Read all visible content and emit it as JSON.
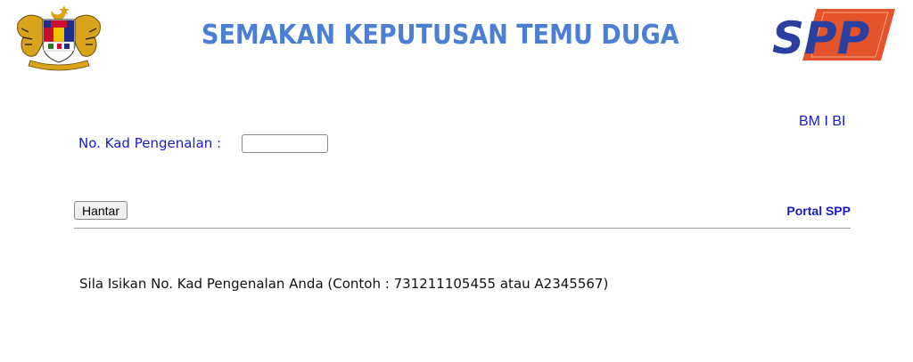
{
  "header": {
    "title": "SEMAKAN KEPUTUSAN TEMU DUGA",
    "crest_icon": "malaysia-coat-of-arms",
    "logo_text": "SPP",
    "logo_colors": {
      "text": "#2a3fa0",
      "accent": "#e5532b"
    }
  },
  "language": {
    "bm_label": "BM",
    "separator": "I",
    "bi_label": "BI"
  },
  "form": {
    "ic_label": "No. Kad Pengenalan :",
    "ic_value": "",
    "submit_label": "Hantar"
  },
  "links": {
    "portal_label": "Portal SPP"
  },
  "instruction": "Sila Isikan No. Kad Pengenalan Anda (Contoh : 731211105455 atau A2345567)",
  "colors": {
    "title": "#4a7fd4",
    "link": "#1a1acc"
  }
}
